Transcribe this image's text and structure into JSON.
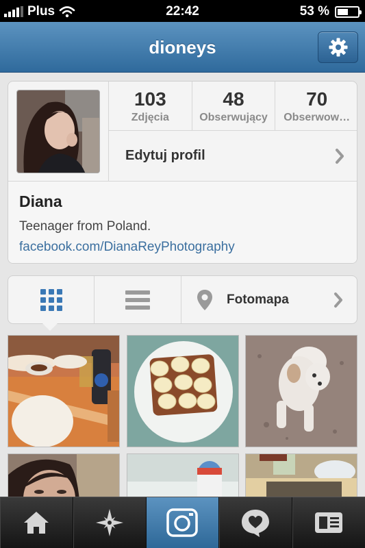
{
  "status_bar": {
    "carrier": "Plus",
    "time": "22:42",
    "battery": "53 %",
    "battery_level": 0.53
  },
  "header": {
    "title": "dioneys",
    "settings_icon": "gear-icon"
  },
  "profile": {
    "stats": [
      {
        "value": "103",
        "label": "Zdjęcia"
      },
      {
        "value": "48",
        "label": "Obserwujący"
      },
      {
        "value": "70",
        "label": "Obserwow…"
      }
    ],
    "edit_label": "Edytuj profil",
    "name": "Diana",
    "bio": "Teenager from Poland.",
    "link": "facebook.com/DianaReyPhotography"
  },
  "view_tabs": {
    "map_label": "Fotomapa"
  },
  "colors": {
    "accent": "#3b6f9f",
    "nav_blue": "#4a80b0",
    "grid_icon_blue": "#3a78b5"
  },
  "bottom_nav": [
    {
      "icon": "home-icon"
    },
    {
      "icon": "explore-icon"
    },
    {
      "icon": "camera-icon",
      "active": true
    },
    {
      "icon": "news-icon"
    },
    {
      "icon": "profile-icon"
    }
  ]
}
